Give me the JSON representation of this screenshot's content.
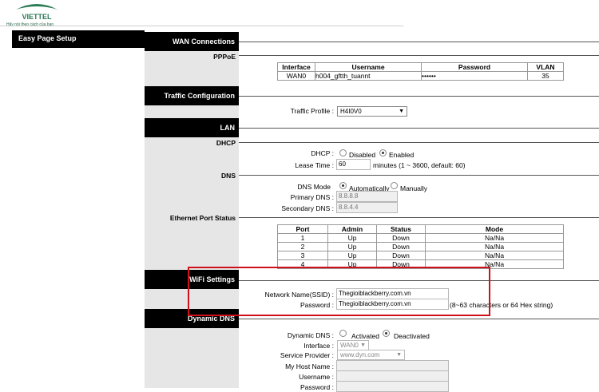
{
  "header": {
    "logo_text": "VIETTEL",
    "tagline": "Hãy nói theo cách của bạn"
  },
  "sidebar": {
    "item": "Easy Page Setup"
  },
  "wan": {
    "title": "WAN Connections",
    "subtitle": "PPPoE",
    "columns": [
      "Interface",
      "Username",
      "Password",
      "VLAN"
    ],
    "row": {
      "interface": "WAN0",
      "username": "h004_gftth_tuannt",
      "password": "••••••",
      "vlan": "35"
    }
  },
  "traffic": {
    "title": "Traffic Configuration",
    "profile_label": "Traffic Profile :",
    "profile_value": "H4I0V0"
  },
  "lan": {
    "title": "LAN",
    "dhcp_sub": "DHCP",
    "dhcp_label": "DHCP :",
    "disabled": "Disabled",
    "enabled": "Enabled",
    "lease_label": "Lease Time :",
    "lease_value": "60",
    "lease_hint": "minutes (1 ~ 3600, default: 60)",
    "dns_sub": "DNS",
    "dns_mode_label": "DNS Mode",
    "auto": "Automatically",
    "manual": "Manually",
    "primary_label": "Primary DNS :",
    "primary_value": "8.8.8.8",
    "secondary_label": "Secondary DNS :",
    "secondary_value": "8.8.4.4",
    "eth_sub": "Ethernet Port Status",
    "eth_columns": [
      "Port",
      "Admin",
      "Status",
      "Mode"
    ],
    "eth_rows": [
      [
        "1",
        "Up",
        "Down",
        "Na/Na"
      ],
      [
        "2",
        "Up",
        "Down",
        "Na/Na"
      ],
      [
        "3",
        "Up",
        "Down",
        "Na/Na"
      ],
      [
        "4",
        "Up",
        "Down",
        "Na/Na"
      ]
    ]
  },
  "wifi": {
    "title": "WiFi Settings",
    "ssid_label": "Network Name(SSID) :",
    "ssid_value": "Thegioiblackberry.com.vn",
    "pass_label": "Password :",
    "pass_value": "Thegioiblackberry.com.vn",
    "pass_hint": "(8~63 characters or 64 Hex string)"
  },
  "ddns": {
    "title": "Dynamic DNS",
    "label": "Dynamic DNS :",
    "activated": "Activated",
    "deactivated": "Deactivated",
    "iface_label": "Interface :",
    "iface_value": "WAN0",
    "provider_label": "Service Provider :",
    "provider_value": "www.dyn.com",
    "host_label": "My Host Name :",
    "user_label": "Username :",
    "pass_label": "Password :"
  },
  "colors": {
    "accent_red": "#d0101a",
    "section_bg": "#000000",
    "label_col_bg": "#e6e6e6"
  }
}
